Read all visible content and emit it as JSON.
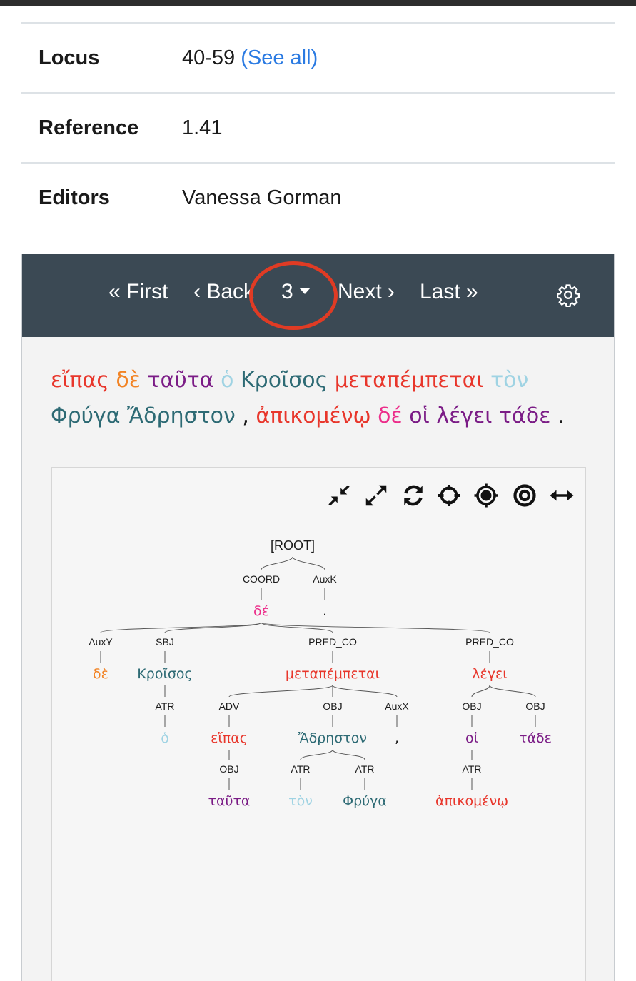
{
  "metadata": {
    "locus_label": "Locus",
    "locus_value": "40-59",
    "locus_link": "(See all)",
    "reference_label": "Reference",
    "reference_value": "1.41",
    "editors_label": "Editors",
    "editors_value": "Vanessa Gorman"
  },
  "navigation": {
    "first": "« First",
    "back": "‹ Back",
    "page": "3",
    "next": "Next ›",
    "last": "Last »"
  },
  "colors": {
    "red": "#e8362b",
    "orange": "#f28324",
    "purple": "#7b1c86",
    "lightblue": "#9fd3e3",
    "teal": "#2d6a74",
    "pink": "#ec2d8a",
    "nav_bg": "#3b4954",
    "link": "#2a7ae2"
  },
  "sentence": [
    {
      "text": "εἴπας",
      "color": "red"
    },
    {
      "text": "δὲ",
      "color": "orange"
    },
    {
      "text": "ταῦτα",
      "color": "purple"
    },
    {
      "text": "ὁ",
      "color": "lightblue"
    },
    {
      "text": "Κροῖσος",
      "color": "teal"
    },
    {
      "text": "μεταπέμπεται",
      "color": "red"
    },
    {
      "text": "τὸν",
      "color": "lightblue"
    },
    {
      "text": "Φρύγα",
      "color": "teal"
    },
    {
      "text": "Ἄδρηστον",
      "color": "teal"
    },
    {
      "text": ",",
      "color": "black"
    },
    {
      "text": "ἀπικομένῳ",
      "color": "red"
    },
    {
      "text": "δέ",
      "color": "pink"
    },
    {
      "text": "οἱ",
      "color": "purple"
    },
    {
      "text": "λέγει",
      "color": "purple"
    },
    {
      "text": "τάδε",
      "color": "purple"
    },
    {
      "text": ".",
      "color": "black"
    }
  ],
  "tree_tools": [
    "collapse-icon",
    "expand-icon",
    "refresh-icon",
    "center-icon",
    "focus-target-icon",
    "focus-ring-icon",
    "width-arrows-icon"
  ],
  "tree": {
    "root": "[ROOT]",
    "nodes": [
      {
        "id": "coord",
        "relation": "COORD",
        "word": "δέ",
        "color": "pink"
      },
      {
        "id": "auxk",
        "relation": "AuxK",
        "word": ".",
        "color": "black"
      },
      {
        "id": "auxy",
        "relation": "AuxY",
        "word": "δὲ",
        "color": "orange"
      },
      {
        "id": "sbj",
        "relation": "SBJ",
        "word": "Κροῖσος",
        "color": "teal"
      },
      {
        "id": "pred1",
        "relation": "PRED_CO",
        "word": "μεταπέμπεται",
        "color": "red"
      },
      {
        "id": "pred2",
        "relation": "PRED_CO",
        "word": "λέγει",
        "color": "red"
      },
      {
        "id": "atr_o",
        "relation": "ATR",
        "word": "ὁ",
        "color": "lightblue"
      },
      {
        "id": "adv",
        "relation": "ADV",
        "word": "εἴπας",
        "color": "red"
      },
      {
        "id": "obj_adr",
        "relation": "OBJ",
        "word": "Ἄδρηστον",
        "color": "teal"
      },
      {
        "id": "auxx",
        "relation": "AuxX",
        "word": ",",
        "color": "black"
      },
      {
        "id": "obj_oi",
        "relation": "OBJ",
        "word": "οἱ",
        "color": "purple"
      },
      {
        "id": "obj_tade",
        "relation": "OBJ",
        "word": "τάδε",
        "color": "purple"
      },
      {
        "id": "obj_tauta",
        "relation": "OBJ",
        "word": "ταῦτα",
        "color": "purple"
      },
      {
        "id": "atr_ton",
        "relation": "ATR",
        "word": "τὸν",
        "color": "lightblue"
      },
      {
        "id": "atr_fryga",
        "relation": "ATR",
        "word": "Φρύγα",
        "color": "teal"
      },
      {
        "id": "atr_apik",
        "relation": "ATR",
        "word": "ἀπικομένῳ",
        "color": "red"
      }
    ]
  }
}
